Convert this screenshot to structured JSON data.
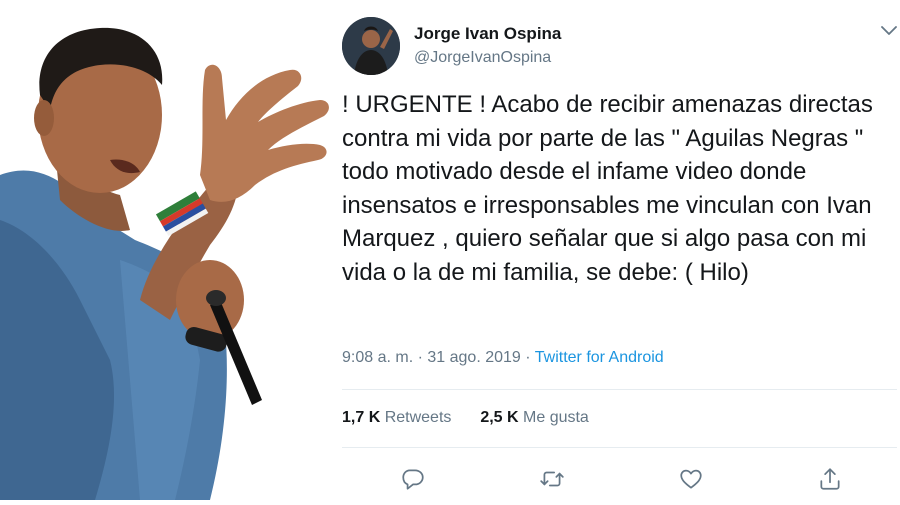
{
  "tweet": {
    "display_name": "Jorge Ivan Ospina",
    "handle": "@JorgeIvanOspina",
    "text": "! URGENTE ! Acabo de recibir amenazas directas contra mi vida por parte de las \" Aguilas Negras \" todo motivado desde el infame video donde insensatos e irresponsables me vinculan con Ivan Marquez , quiero señalar que si algo pasa con mi vida o la de mi familia, se debe: ( Hilo)",
    "time": "9:08 a. m.",
    "date": "31 ago. 2019",
    "separator": "·",
    "source": "Twitter for Android",
    "retweets_count": "1,7 K",
    "retweets_label": "Retweets",
    "likes_count": "2,5 K",
    "likes_label": "Me gusta"
  },
  "colors": {
    "text": "#14171a",
    "secondary": "#657786",
    "link": "#1b95e0",
    "divider": "#e6ecf0"
  },
  "icons": {
    "menu": "chevron-down-icon",
    "reply": "reply-icon",
    "retweet": "retweet-icon",
    "like": "heart-icon",
    "share": "share-icon"
  }
}
